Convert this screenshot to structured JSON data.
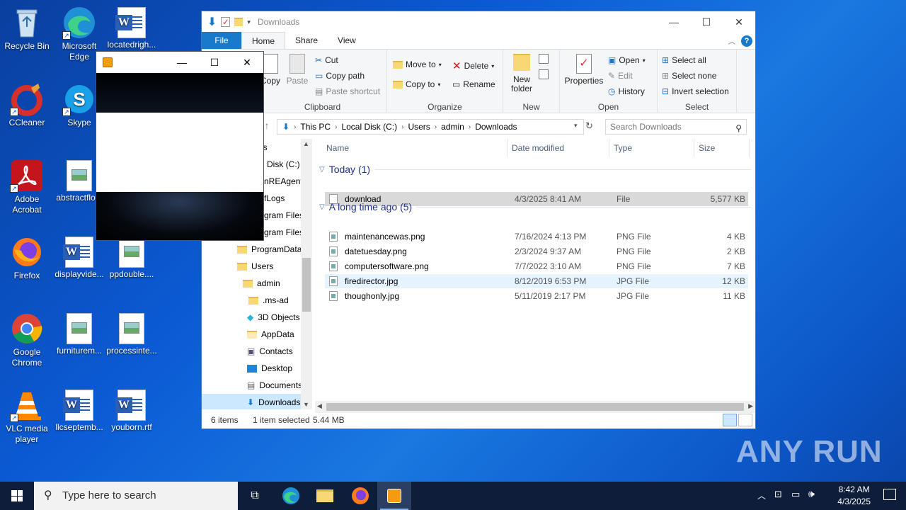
{
  "desktop": {
    "icons": [
      {
        "label": "Recycle Bin"
      },
      {
        "label": "Microsoft Edge"
      },
      {
        "label": "locatedrigh..."
      },
      {
        "label": "CCleaner"
      },
      {
        "label": "Skype"
      },
      {
        "label": "Adobe Acrobat"
      },
      {
        "label": "abstractflo..."
      },
      {
        "label": "Firefox"
      },
      {
        "label": "displayvide..."
      },
      {
        "label": "ppdouble...."
      },
      {
        "label": "Google Chrome"
      },
      {
        "label": "furniturem..."
      },
      {
        "label": "processinte..."
      },
      {
        "label": "VLC media player"
      },
      {
        "label": "llcseptemb..."
      },
      {
        "label": "youborn.rtf"
      }
    ]
  },
  "explorer": {
    "title": "Downloads",
    "tabs": [
      "File",
      "Home",
      "Share",
      "View"
    ],
    "ribbon": {
      "clipboard": {
        "name": "Clipboard",
        "copy": "Copy",
        "paste": "Paste",
        "cut": "Cut",
        "copy_path": "Copy path",
        "paste_shortcut": "Paste shortcut"
      },
      "organize": {
        "name": "Organize",
        "move_to": "Move to",
        "copy_to": "Copy to",
        "delete": "Delete",
        "rename": "Rename"
      },
      "new": {
        "name": "New",
        "new_folder": "New folder"
      },
      "open": {
        "name": "Open",
        "properties": "Properties",
        "open": "Open",
        "edit": "Edit",
        "history": "History"
      },
      "select": {
        "name": "Select",
        "select_all": "Select all",
        "select_none": "Select none",
        "invert": "Invert selection"
      }
    },
    "address": {
      "crumbs": [
        "This PC",
        "Local Disk (C:)",
        "Users",
        "admin",
        "Downloads"
      ]
    },
    "search": {
      "placeholder": "Search Downloads"
    },
    "nav": [
      {
        "label": "ps"
      },
      {
        "label": "Disk (C:)"
      },
      {
        "label": "nREAgent"
      },
      {
        "label": "fLogs"
      },
      {
        "label": "gram Files"
      },
      {
        "label": "gram Files"
      },
      {
        "label": "ProgramData"
      },
      {
        "label": "Users"
      },
      {
        "label": "admin"
      },
      {
        "label": ".ms-ad"
      },
      {
        "label": "3D Objects"
      },
      {
        "label": "AppData"
      },
      {
        "label": "Contacts"
      },
      {
        "label": "Desktop"
      },
      {
        "label": "Documents"
      },
      {
        "label": "Downloads"
      }
    ],
    "columns": {
      "name": "Name",
      "date": "Date modified",
      "type": "Type",
      "size": "Size"
    },
    "groups": {
      "today": "Today (1)",
      "longago": "A long time ago (5)"
    },
    "files": [
      {
        "name": "download",
        "date": "4/3/2025 8:41 AM",
        "type": "File",
        "size": "5,577 KB"
      },
      {
        "name": "maintenancewas.png",
        "date": "7/16/2024 4:13 PM",
        "type": "PNG File",
        "size": "4 KB"
      },
      {
        "name": "datetuesday.png",
        "date": "2/3/2024 9:37 AM",
        "type": "PNG File",
        "size": "2 KB"
      },
      {
        "name": "computersoftware.png",
        "date": "7/7/2022 3:10 AM",
        "type": "PNG File",
        "size": "7 KB"
      },
      {
        "name": "firedirector.jpg",
        "date": "8/12/2019 6:53 PM",
        "type": "JPG File",
        "size": "12 KB"
      },
      {
        "name": "thoughonly.jpg",
        "date": "5/11/2019 2:17 PM",
        "type": "JPG File",
        "size": "11 KB"
      }
    ],
    "status": {
      "items": "6 items",
      "selected": "1 item selected",
      "size": "5.44 MB"
    }
  },
  "taskbar": {
    "search_placeholder": "Type here to search",
    "time": "8:42 AM",
    "date": "4/3/2025"
  },
  "watermark": "ANY RUN",
  "colors": {
    "accent": "#1979ca",
    "selection": "#cce8ff",
    "taskbar": "#0d1d3a"
  }
}
